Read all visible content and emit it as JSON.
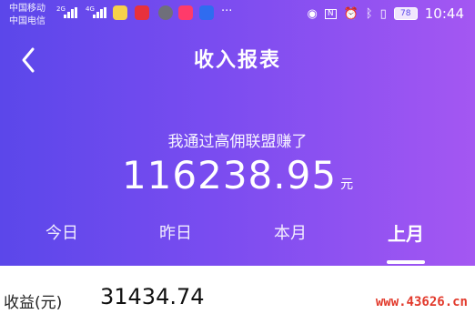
{
  "status_bar": {
    "carrier1": "中国移动",
    "carrier2": "中国电信",
    "net1": "2G",
    "net2": "4G",
    "more": "···",
    "battery": "78",
    "time": "10:44"
  },
  "header": {
    "title": "收入报表",
    "back_icon": "chevron-left-icon"
  },
  "summary": {
    "caption": "我通过高佣联盟赚了",
    "amount": "116238.95",
    "unit": "元"
  },
  "tabs": [
    {
      "label": "今日"
    },
    {
      "label": "昨日"
    },
    {
      "label": "本月"
    },
    {
      "label": "上月",
      "active": true
    }
  ],
  "earnings": {
    "label": "收益(元)",
    "value": "31434.74"
  },
  "watermark": "www.43626.cn",
  "colors": {
    "gradient_start": "#5b47ea",
    "gradient_end": "#a457f2",
    "watermark": "#e23a2c"
  }
}
